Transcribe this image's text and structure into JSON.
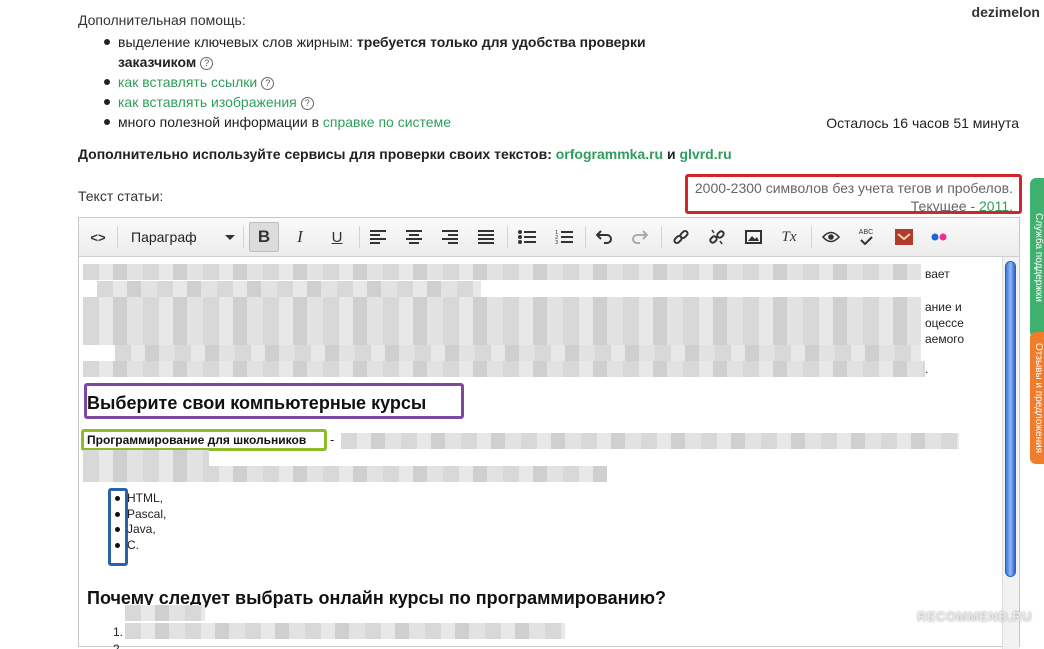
{
  "user": {
    "name": "dezimelon"
  },
  "help": {
    "title": "Дополнительная помощь:",
    "items": [
      {
        "text_plain": "выделение ключевых слов жирным: ",
        "text_bold": "требуется только для удобства проверки заказчиком"
      },
      {
        "link": "как вставлять ссылки"
      },
      {
        "link": "как вставлять изображения"
      },
      {
        "text_plain": "много полезной информации в ",
        "link": "справке по системе"
      }
    ],
    "qmark": "?"
  },
  "time_left": "Осталось 16 часов 51 минута",
  "services": {
    "prefix": "Дополнительно используйте сервисы для проверки своих текстов:",
    "link1": "orfogrammka.ru",
    "and": "и",
    "link2": "glvrd.ru"
  },
  "article_label": "Текст статьи:",
  "counter": {
    "requirement": "2000-2300 символов без учета тегов и пробелов.",
    "current_label": "Текущее -",
    "current_value": "2011",
    "dot": "."
  },
  "toolbar": {
    "format": "Параграф",
    "icons": [
      "code-icon",
      "bold-icon",
      "italic-icon",
      "underline-icon",
      "align-left-icon",
      "align-center-icon",
      "align-right-icon",
      "align-justify-icon",
      "bullet-list-icon",
      "numbered-list-icon",
      "undo-icon",
      "redo-icon",
      "link-icon",
      "unlink-icon",
      "image-icon",
      "clear-format-icon",
      "preview-icon",
      "spellcheck-icon",
      "bookmark-icon",
      "flickr-icon"
    ],
    "glyphs": {
      "code": "<>",
      "bold": "B",
      "italic": "I",
      "underline": "U",
      "clear": "Tx",
      "abc": "ABC"
    }
  },
  "content": {
    "side_fragments": [
      "вает",
      "ание и",
      "оцессе",
      "аемого",
      "."
    ],
    "heading1": "Выберите свои компьютерные курсы",
    "heading2": "Программирование для школьников",
    "dash": "-",
    "languages": [
      "HTML,",
      "Pascal,",
      "Java,",
      "C."
    ],
    "heading3": "Почему следует выбрать онлайн курсы по программированию?",
    "ol_numbers": [
      "1.",
      "2."
    ]
  },
  "side_tabs": {
    "green": "Служба поддержки",
    "orange": "Отзывы и предложения"
  },
  "watermark": "RECOMMEND.RU",
  "colors": {
    "link": "#2f9e5b",
    "counter_border": "#d0262c",
    "h2_border": "#7b4aa0",
    "h3_border": "#8dbb2a",
    "list_border": "#2c62a9"
  }
}
